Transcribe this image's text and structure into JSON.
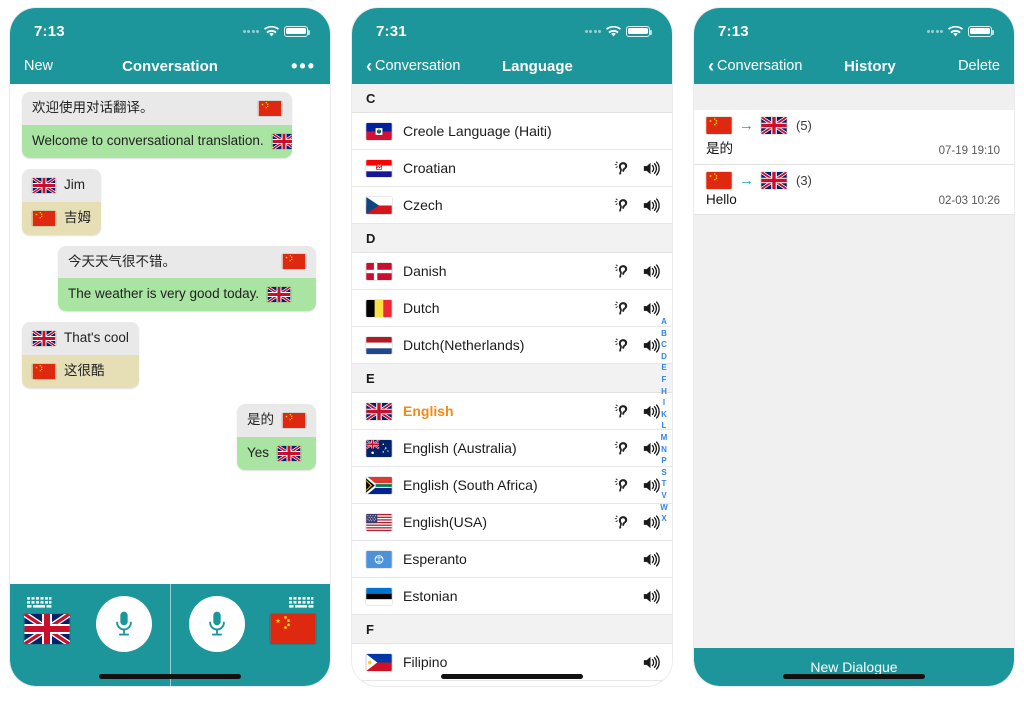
{
  "colors": {
    "teal": "#1c969b",
    "bubble_grey": "#e9e9e9",
    "bubble_green": "#a9e4a2",
    "bubble_khaki": "#e6dfb6",
    "selected_orange": "#f28a14",
    "index_blue": "#2f86e8",
    "arrow_teal": "#1fa8a0"
  },
  "conversation": {
    "status": {
      "time": "7:13"
    },
    "nav": {
      "left_label": "New",
      "title": "Conversation",
      "right_label": "•••"
    },
    "messages": [
      {
        "id": "welcome",
        "align": "left",
        "lines": [
          {
            "text": "欢迎使用对话翻译。",
            "style": "grey",
            "flag": "cn",
            "flag_side": "right",
            "wide": true
          },
          {
            "text": "Welcome to conversational translation.",
            "style": "green",
            "flag": "gb",
            "flag_side": "right",
            "wide": false
          }
        ]
      },
      {
        "id": "jim",
        "align": "left",
        "lines": [
          {
            "text": "Jim",
            "style": "grey",
            "flag": "gb",
            "flag_side": "left",
            "wide": false
          },
          {
            "text": "吉姆",
            "style": "khaki",
            "flag": "cn",
            "flag_side": "left",
            "wide": false
          }
        ]
      },
      {
        "id": "weather",
        "align": "right",
        "lines": [
          {
            "text": "今天天气很不错。",
            "style": "grey",
            "flag": "cn",
            "flag_side": "right",
            "wide": true
          },
          {
            "text": "The weather is very good today.",
            "style": "green",
            "flag": "gb",
            "flag_side": "right",
            "wide": false
          }
        ]
      },
      {
        "id": "thats-cool",
        "align": "left",
        "lines": [
          {
            "text": "That's cool",
            "style": "grey",
            "flag": "gb",
            "flag_side": "left",
            "wide": false
          },
          {
            "text": "这很酷",
            "style": "khaki",
            "flag": "cn",
            "flag_side": "left",
            "wide": false
          }
        ]
      },
      {
        "id": "yes",
        "align": "right",
        "lines": [
          {
            "text": "是的",
            "style": "grey",
            "flag": "cn",
            "flag_side": "right",
            "wide": false
          },
          {
            "text": "Yes",
            "style": "green",
            "flag": "gb",
            "flag_side": "right",
            "wide": false
          }
        ]
      }
    ],
    "toolbar": {
      "left_keyboard": "keyboard-icon",
      "left_flag": "gb",
      "left_mic": "microphone-icon",
      "right_mic": "microphone-icon",
      "right_keyboard": "keyboard-icon",
      "right_flag": "cn"
    }
  },
  "language": {
    "status": {
      "time": "7:31"
    },
    "nav": {
      "back_label": "Conversation",
      "title": "Language"
    },
    "sections": [
      {
        "letter": "C",
        "rows": [
          {
            "name": "Creole Language (Haiti)",
            "flag": "ht",
            "ear": false,
            "speaker": false,
            "selected": false
          },
          {
            "name": "Croatian",
            "flag": "hr",
            "ear": true,
            "speaker": true,
            "selected": false
          },
          {
            "name": "Czech",
            "flag": "cz",
            "ear": true,
            "speaker": true,
            "selected": false
          }
        ]
      },
      {
        "letter": "D",
        "rows": [
          {
            "name": "Danish",
            "flag": "dk",
            "ear": true,
            "speaker": true,
            "selected": false
          },
          {
            "name": "Dutch",
            "flag": "be",
            "ear": true,
            "speaker": true,
            "selected": false
          },
          {
            "name": "Dutch(Netherlands)",
            "flag": "nl",
            "ear": true,
            "speaker": true,
            "selected": false
          }
        ]
      },
      {
        "letter": "E",
        "rows": [
          {
            "name": "English",
            "flag": "gb",
            "ear": true,
            "speaker": true,
            "selected": true
          },
          {
            "name": "English (Australia)",
            "flag": "au",
            "ear": true,
            "speaker": true,
            "selected": false
          },
          {
            "name": "English (South Africa)",
            "flag": "za",
            "ear": true,
            "speaker": true,
            "selected": false
          },
          {
            "name": "English(USA)",
            "flag": "us",
            "ear": true,
            "speaker": true,
            "selected": false
          },
          {
            "name": "Esperanto",
            "flag": "eo",
            "ear": false,
            "speaker": true,
            "selected": false
          },
          {
            "name": "Estonian",
            "flag": "ee",
            "ear": false,
            "speaker": true,
            "selected": false
          }
        ]
      },
      {
        "letter": "F",
        "rows": [
          {
            "name": "Filipino",
            "flag": "ph",
            "ear": false,
            "speaker": true,
            "selected": false
          }
        ]
      }
    ],
    "index": [
      "A",
      "B",
      "C",
      "D",
      "E",
      "F",
      "H",
      "I",
      "K",
      "L",
      "M",
      "N",
      "P",
      "S",
      "T",
      "V",
      "W",
      "X"
    ]
  },
  "history": {
    "status": {
      "time": "7:13"
    },
    "nav": {
      "back_label": "Conversation",
      "title": "History",
      "right_label": "Delete"
    },
    "items": [
      {
        "from_flag": "cn",
        "to_flag": "gb",
        "count": "(5)",
        "text": "是的",
        "time": "07-19 19:10"
      },
      {
        "from_flag": "cn",
        "to_flag": "gb",
        "count": "(3)",
        "text": "Hello",
        "time": "02-03 10:26"
      }
    ],
    "footer_label": "New Dialogue"
  }
}
